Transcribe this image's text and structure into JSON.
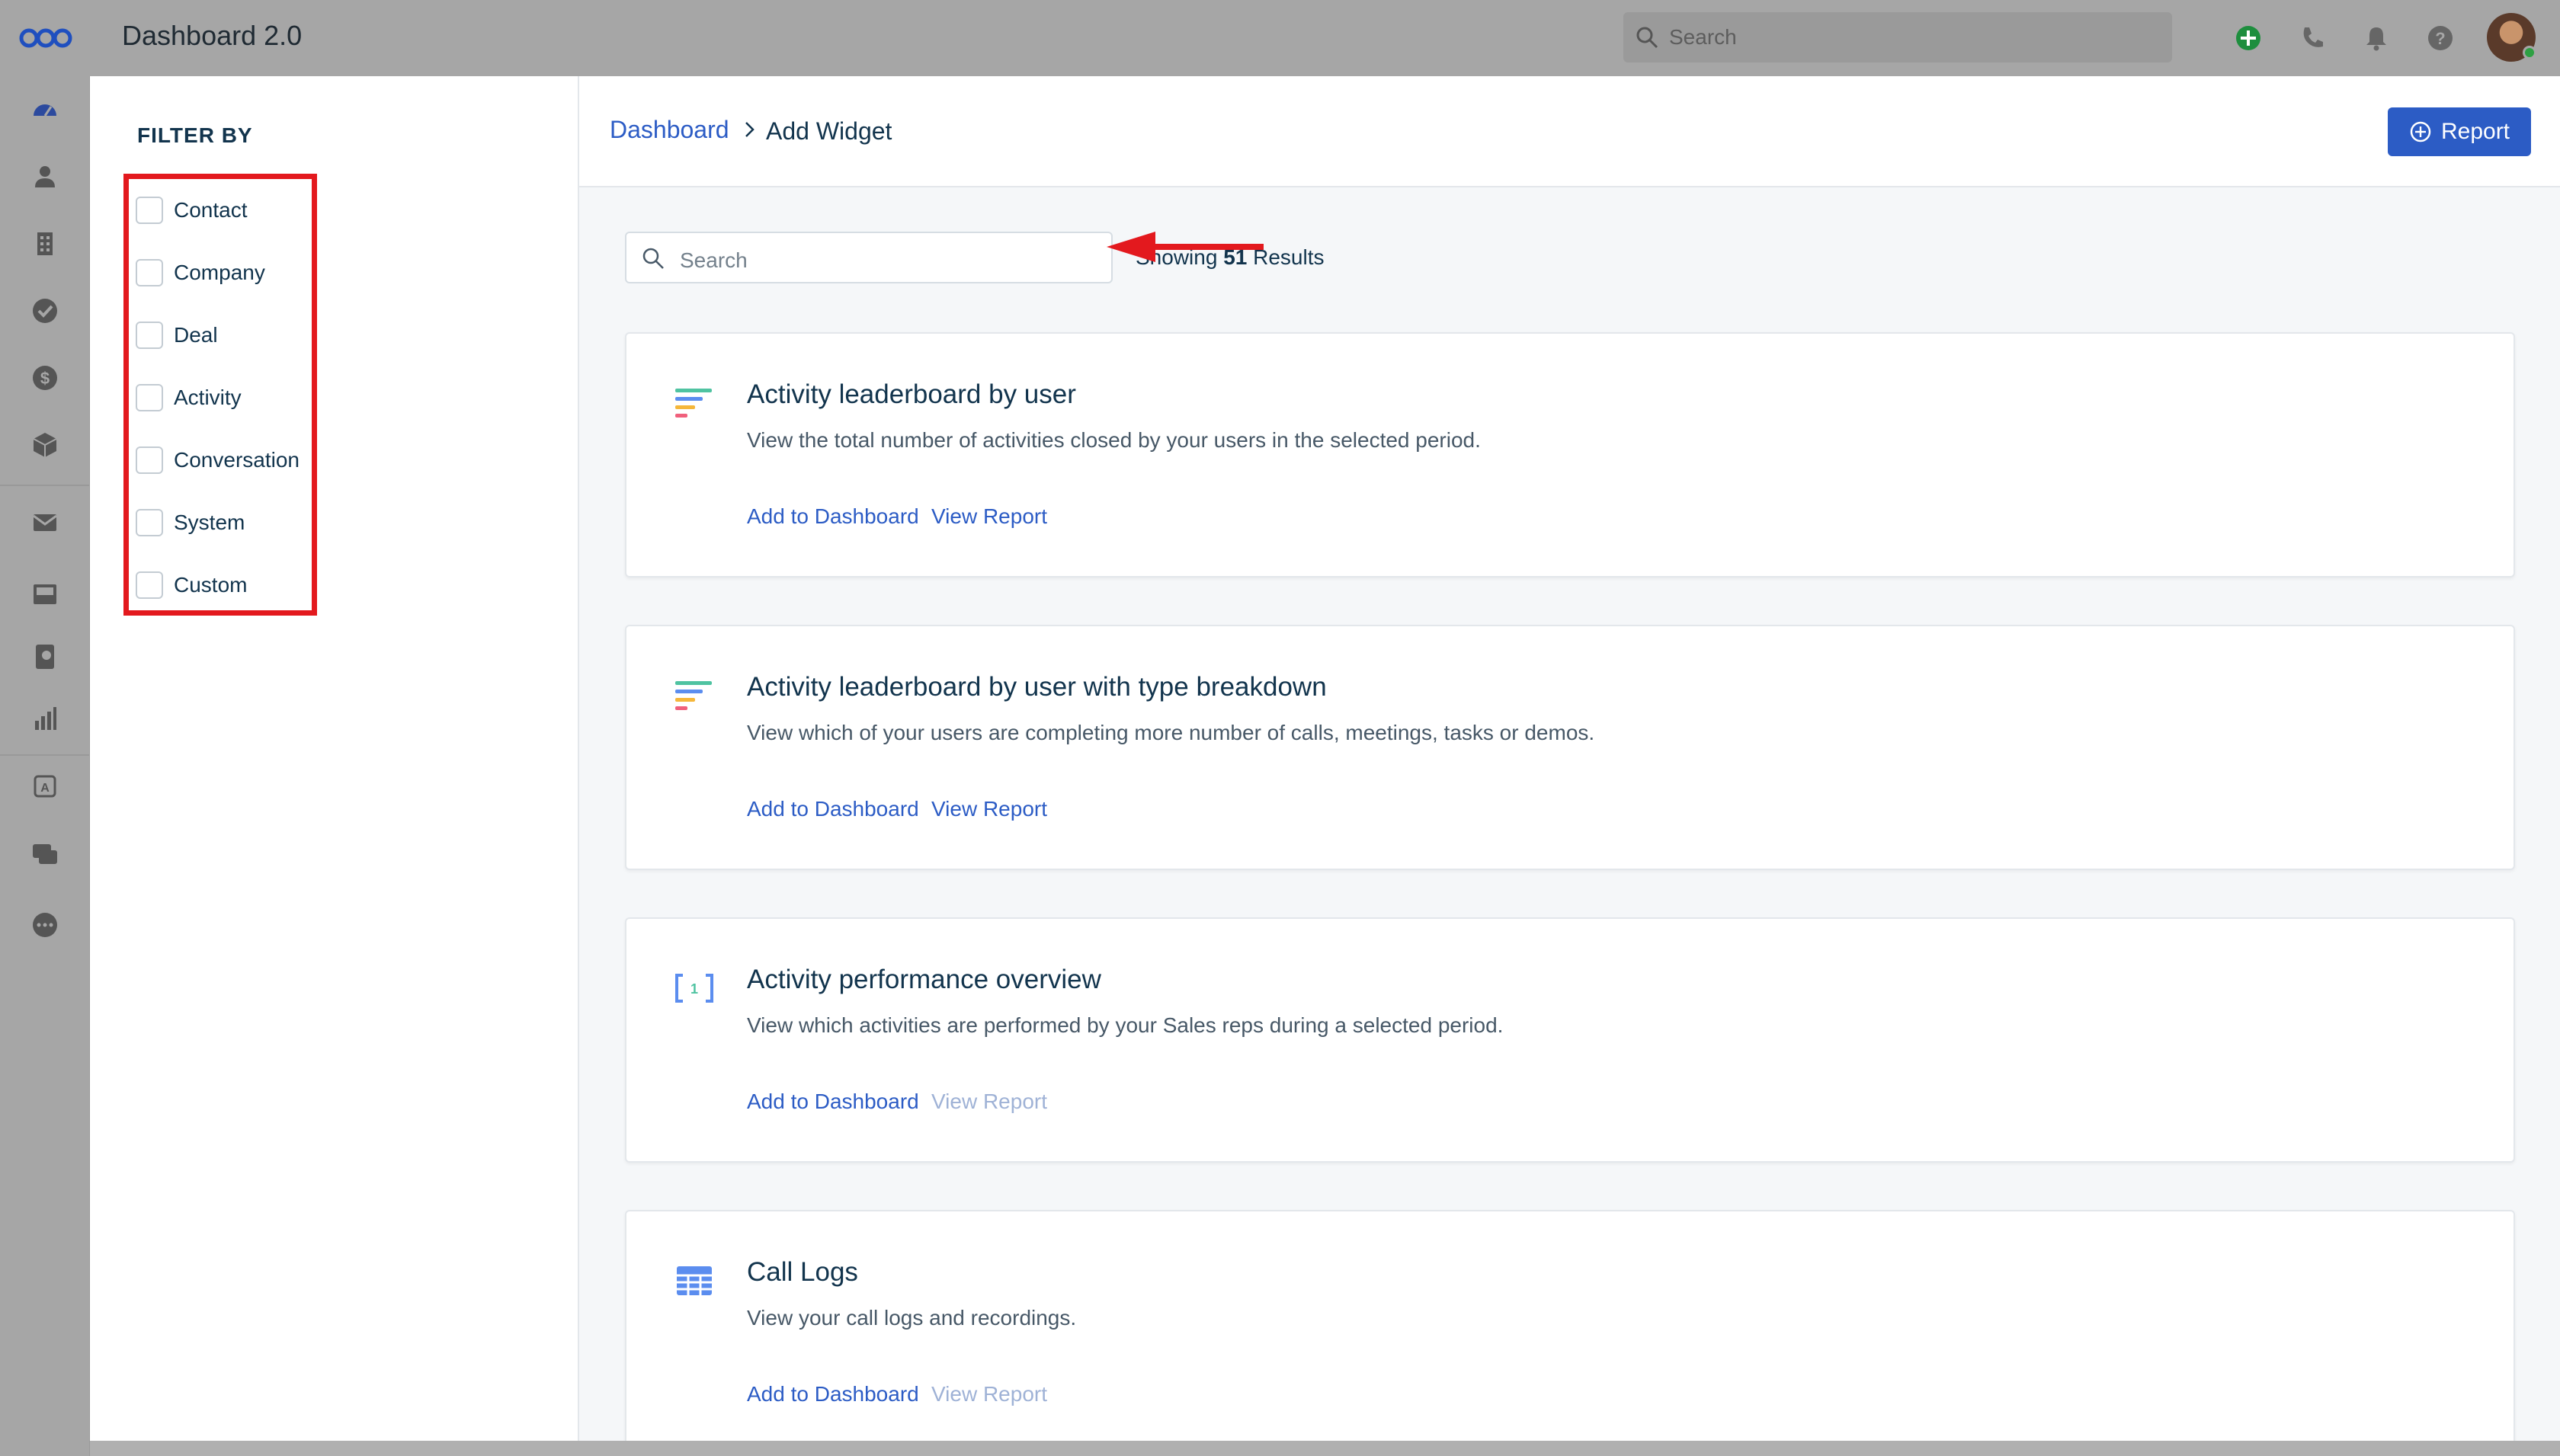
{
  "app": {
    "title": "Dashboard 2.0",
    "search_placeholder": "Search"
  },
  "filter": {
    "title": "FILTER BY",
    "items": [
      "Contact",
      "Company",
      "Deal",
      "Activity",
      "Conversation",
      "System",
      "Custom"
    ]
  },
  "breadcrumb": {
    "parent": "Dashboard",
    "current": "Add Widget"
  },
  "report_button": {
    "label": "Report"
  },
  "list": {
    "search_placeholder": "Search",
    "results_prefix": "Showing",
    "results_count": "51",
    "results_suffix": "Results"
  },
  "widgets": [
    {
      "title": "Activity leaderboard by user",
      "description": "View the total number of activities closed by your users in the selected period.",
      "add_label": "Add to Dashboard",
      "view_label": "View Report",
      "view_enabled": true,
      "icon": "leaderboard-icon"
    },
    {
      "title": "Activity leaderboard by user with type breakdown",
      "description": "View which of your users are completing more number of calls, meetings, tasks or demos.",
      "add_label": "Add to Dashboard",
      "view_label": "View Report",
      "view_enabled": true,
      "icon": "leaderboard-icon"
    },
    {
      "title": "Activity performance overview",
      "description": "View which activities are performed by your Sales reps during a selected period.",
      "add_label": "Add to Dashboard",
      "view_label": "View Report",
      "view_enabled": false,
      "icon": "metric-bracket-icon"
    },
    {
      "title": "Call Logs",
      "description": "View your call logs and recordings.",
      "add_label": "Add to Dashboard",
      "view_label": "View Report",
      "view_enabled": false,
      "icon": "table-grid-icon"
    }
  ],
  "colors": {
    "accent": "#2c5cc5",
    "highlight": "#e3191e",
    "chrome": "#a6a6a6"
  }
}
